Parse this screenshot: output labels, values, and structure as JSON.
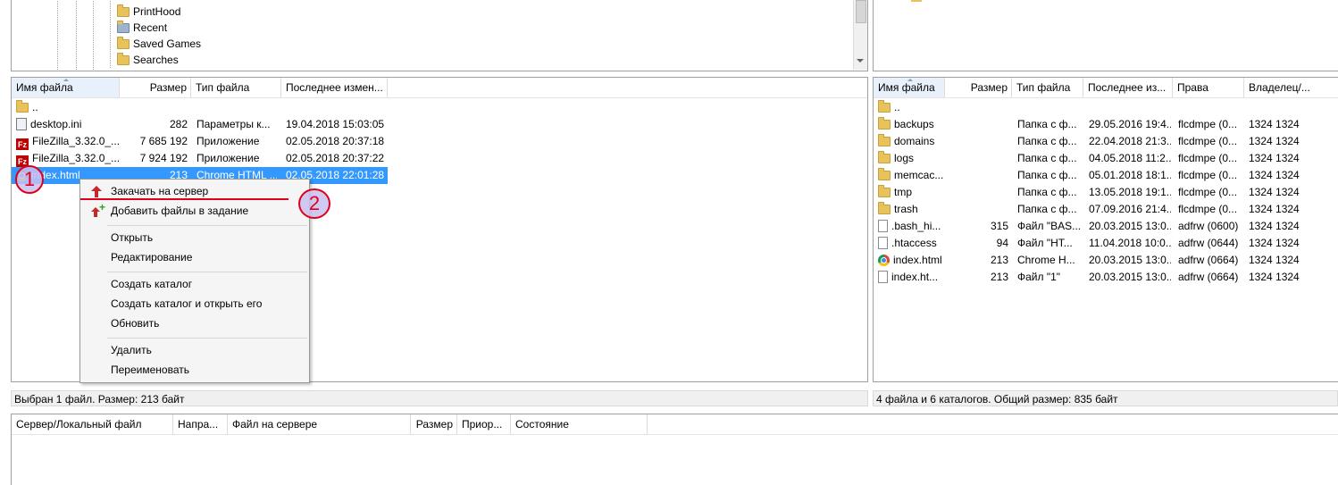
{
  "local_tree": {
    "items": [
      {
        "label": "PrintHood",
        "icon": "folder-icon"
      },
      {
        "label": "Recent",
        "icon": "folder-shortcut-icon"
      },
      {
        "label": "Saved Games",
        "icon": "folder-icon"
      },
      {
        "label": "Searches",
        "icon": "folder-search-icon"
      }
    ]
  },
  "local_list": {
    "headers": [
      "Имя файла",
      "Размер",
      "Тип файла",
      "Последнее измен..."
    ],
    "rows": [
      {
        "name": "..",
        "size": "",
        "type": "",
        "modified": "",
        "icon": "folder-icon"
      },
      {
        "name": "desktop.ini",
        "size": "282",
        "type": "Параметры к...",
        "modified": "19.04.2018 15:03:05",
        "icon": "ini-file-icon"
      },
      {
        "name": "FileZilla_3.32.0_...",
        "size": "7 685 192",
        "type": "Приложение",
        "modified": "02.05.2018 20:37:18",
        "icon": "filezilla-icon"
      },
      {
        "name": "FileZilla_3.32.0_...",
        "size": "7 924 192",
        "type": "Приложение",
        "modified": "02.05.2018 20:37:22",
        "icon": "filezilla-icon"
      },
      {
        "name": "index.html",
        "size": "213",
        "type": "Chrome HTML ...",
        "modified": "02.05.2018 22:01:28",
        "icon": "chrome-icon",
        "selected": true
      }
    ],
    "status": "Выбран 1 файл. Размер: 213 байт"
  },
  "remote_list": {
    "headers": [
      "Имя файла",
      "Размер",
      "Тип файла",
      "Последнее из...",
      "Права",
      "Владелец/..."
    ],
    "rows": [
      {
        "name": "..",
        "size": "",
        "type": "",
        "modified": "",
        "perms": "",
        "owner": "",
        "icon": "folder-icon"
      },
      {
        "name": "backups",
        "size": "",
        "type": "Папка с ф...",
        "modified": "29.05.2016 19:4...",
        "perms": "flcdmpe (0...",
        "owner": "1324 1324",
        "icon": "folder-icon"
      },
      {
        "name": "domains",
        "size": "",
        "type": "Папка с ф...",
        "modified": "22.04.2018 21:3...",
        "perms": "flcdmpe (0...",
        "owner": "1324 1324",
        "icon": "folder-icon"
      },
      {
        "name": "logs",
        "size": "",
        "type": "Папка с ф...",
        "modified": "04.05.2018 11:2...",
        "perms": "flcdmpe (0...",
        "owner": "1324 1324",
        "icon": "folder-icon"
      },
      {
        "name": "memcac...",
        "size": "",
        "type": "Папка с ф...",
        "modified": "05.01.2018 18:1...",
        "perms": "flcdmpe (0...",
        "owner": "1324 1324",
        "icon": "folder-icon"
      },
      {
        "name": "tmp",
        "size": "",
        "type": "Папка с ф...",
        "modified": "13.05.2018 19:1...",
        "perms": "flcdmpe (0...",
        "owner": "1324 1324",
        "icon": "folder-icon"
      },
      {
        "name": "trash",
        "size": "",
        "type": "Папка с ф...",
        "modified": "07.09.2016 21:4...",
        "perms": "flcdmpe (0...",
        "owner": "1324 1324",
        "icon": "folder-icon"
      },
      {
        "name": ".bash_hi...",
        "size": "315",
        "type": "Файл \"BAS...",
        "modified": "20.03.2015 13:0...",
        "perms": "adfrw (0600)",
        "owner": "1324 1324",
        "icon": "file-icon"
      },
      {
        "name": ".htaccess",
        "size": "94",
        "type": "Файл \"HT...",
        "modified": "11.04.2018 10:0...",
        "perms": "adfrw (0644)",
        "owner": "1324 1324",
        "icon": "file-icon"
      },
      {
        "name": "index.html",
        "size": "213",
        "type": "Chrome H...",
        "modified": "20.03.2015 13:0...",
        "perms": "adfrw (0664)",
        "owner": "1324 1324",
        "icon": "chrome-icon"
      },
      {
        "name": "index.ht...",
        "size": "213",
        "type": "Файл \"1\"",
        "modified": "20.03.2015 13:0...",
        "perms": "adfrw (0664)",
        "owner": "1324 1324",
        "icon": "file-icon"
      }
    ],
    "status": "4 файла и 6 каталогов. Общий размер: 835 байт"
  },
  "context_menu": {
    "items": [
      {
        "label": "Закачать на сервер",
        "icon": "upload-arrow-icon"
      },
      {
        "label": "Добавить файлы в задание",
        "icon": "add-to-queue-icon"
      },
      {
        "label": "Открыть"
      },
      {
        "label": "Редактирование"
      },
      {
        "label": "Создать каталог"
      },
      {
        "label": "Создать каталог и открыть его"
      },
      {
        "label": "Обновить"
      },
      {
        "label": "Удалить"
      },
      {
        "label": "Переименовать"
      }
    ]
  },
  "queue": {
    "headers": [
      "Сервер/Локальный файл",
      "Напра...",
      "Файл на сервере",
      "Размер",
      "Приор...",
      "Состояние"
    ]
  },
  "annotations": {
    "marker1": "1",
    "marker2": "2",
    "color": "#e0001b",
    "fill": "#c8c0f0"
  }
}
